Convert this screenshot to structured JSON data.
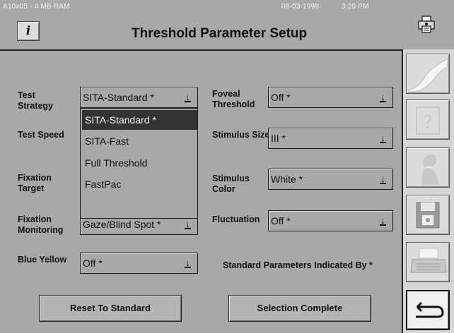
{
  "system": {
    "model": "A10x05 - 4 MB RAM",
    "date": "08-03-1998",
    "time": "3:20 PM"
  },
  "header": {
    "title": "Threshold Parameter Setup",
    "info_label": "i"
  },
  "fields": {
    "test_strategy": {
      "label": "Test\nStrategy",
      "value": "SITA-Standard  *"
    },
    "test_speed": {
      "label": "Test Speed"
    },
    "fixation_target": {
      "label": "Fixation\nTarget"
    },
    "fixation_monitoring": {
      "label": "Fixation\nMonitoring",
      "value": "Gaze/Blind Spot *"
    },
    "blue_yellow": {
      "label": "Blue Yellow",
      "value": "Off  *"
    },
    "foveal_threshold": {
      "label": "Foveal\nThreshold",
      "value": "Off  *"
    },
    "stimulus_size": {
      "label": "Stimulus Size",
      "value": "III  *"
    },
    "stimulus_color": {
      "label": "Stimulus\nColor",
      "value": "White  *"
    },
    "fluctuation": {
      "label": "Fluctuation",
      "value": "Off  *"
    }
  },
  "dropdown_options": [
    "SITA-Standard  *",
    "SITA-Fast",
    "Full Threshold",
    "FastPac"
  ],
  "selected_option_index": 0,
  "note": "Standard Parameters Indicated By *",
  "buttons": {
    "reset": "Reset To Standard",
    "complete": "Selection Complete"
  },
  "sidebar": {
    "icons": [
      "wave-icon",
      "help-icon",
      "patient-profile-icon",
      "floppy-disk-icon",
      "printer-icon",
      "return-arrow-icon"
    ]
  },
  "icons": {
    "top_right": "printer-lock-icon"
  }
}
